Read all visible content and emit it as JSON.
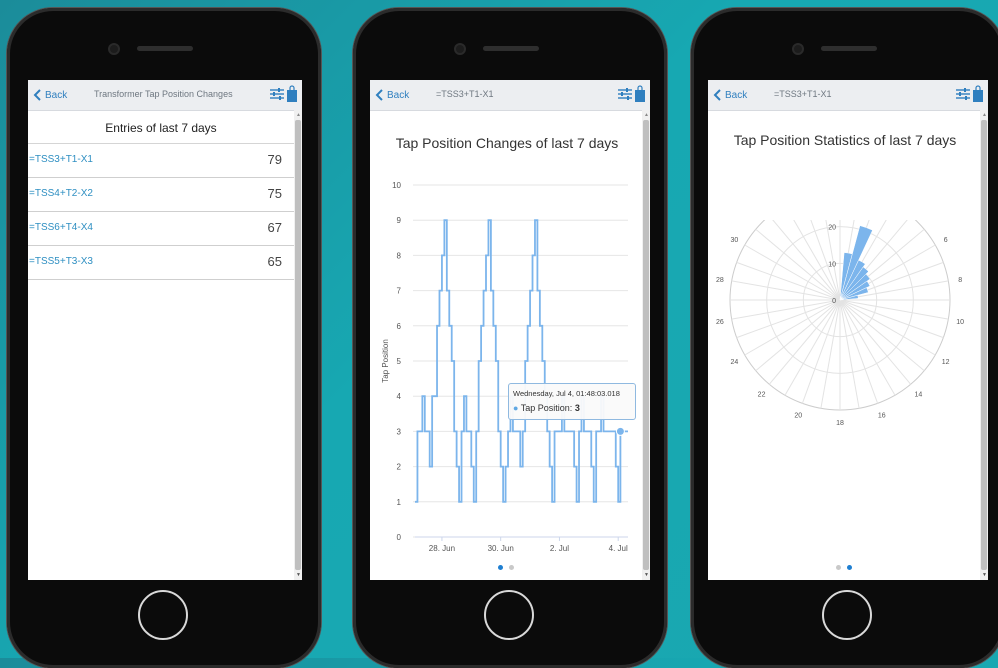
{
  "screens": [
    {
      "nav": {
        "back_label": "Back",
        "title": "Transformer Tap Position Changes"
      },
      "list": {
        "header": "Entries of last 7 days",
        "rows": [
          {
            "name": "=TSS3+T1-X1",
            "count": "79"
          },
          {
            "name": "=TSS4+T2-X2",
            "count": "75"
          },
          {
            "name": "=TSS6+T4-X4",
            "count": "67"
          },
          {
            "name": "=TSS5+T3-X3",
            "count": "65"
          }
        ]
      }
    },
    {
      "nav": {
        "back_label": "Back",
        "title": "=TSS3+T1-X1"
      },
      "pager": {
        "active": 0,
        "count": 2
      }
    },
    {
      "nav": {
        "back_label": "Back",
        "title": "=TSS3+T1-X1"
      },
      "pager": {
        "active": 1,
        "count": 2
      }
    }
  ],
  "colors": {
    "accent": "#2f7fbf",
    "series": "#7cb5ec",
    "link": "#2f8fc2"
  },
  "icons": [
    "chevron-left-icon",
    "filter-sliders-icon",
    "shopping-bag-icon"
  ],
  "chart_data": [
    {
      "type": "line",
      "title": "Tap Position Changes of last 7 days",
      "ylabel": "Tap Position",
      "ylim": [
        0,
        10
      ],
      "yticks": [
        "0",
        "1",
        "2",
        "3",
        "4",
        "5",
        "6",
        "7",
        "8",
        "9",
        "10"
      ],
      "xticks": [
        "28. Jun",
        "30. Jun",
        "2. Jul",
        "4. Jul"
      ],
      "x_unit": "date",
      "x": [
        "2018-06-27 02:00",
        "2018-06-27 04:00",
        "2018-06-27 08:00",
        "2018-06-27 10:00",
        "2018-06-27 14:00",
        "2018-06-27 16:00",
        "2018-06-27 20:00",
        "2018-06-27 22:00",
        "2018-06-28 00:00",
        "2018-06-28 02:00",
        "2018-06-28 04:00",
        "2018-06-28 06:00",
        "2018-06-28 08:00",
        "2018-06-28 10:00",
        "2018-06-28 12:00",
        "2018-06-28 14:00",
        "2018-06-28 16:00",
        "2018-06-28 18:00",
        "2018-06-28 20:00",
        "2018-06-28 22:00",
        "2018-06-29 00:00",
        "2018-06-29 02:00",
        "2018-06-29 04:00",
        "2018-06-29 06:00",
        "2018-06-29 08:00",
        "2018-06-29 10:00",
        "2018-06-29 12:00",
        "2018-06-29 14:00",
        "2018-06-29 16:00",
        "2018-06-29 18:00",
        "2018-06-29 20:00",
        "2018-06-29 22:00",
        "2018-06-30 00:00",
        "2018-06-30 02:00",
        "2018-06-30 04:00",
        "2018-06-30 06:00",
        "2018-06-30 08:00",
        "2018-06-30 10:00",
        "2018-06-30 12:00",
        "2018-06-30 14:00",
        "2018-06-30 16:00",
        "2018-06-30 18:00",
        "2018-06-30 20:00",
        "2018-06-30 22:00",
        "2018-07-01 00:00",
        "2018-07-01 02:00",
        "2018-07-01 04:00",
        "2018-07-01 06:00",
        "2018-07-01 08:00",
        "2018-07-01 10:00",
        "2018-07-01 12:00",
        "2018-07-01 14:00",
        "2018-07-01 16:00",
        "2018-07-01 18:00",
        "2018-07-01 20:00",
        "2018-07-01 22:00",
        "2018-07-02 00:00",
        "2018-07-02 02:00",
        "2018-07-02 04:00",
        "2018-07-02 06:00",
        "2018-07-02 08:00",
        "2018-07-02 10:00",
        "2018-07-02 12:00",
        "2018-07-02 14:00",
        "2018-07-02 16:00",
        "2018-07-02 18:00",
        "2018-07-02 20:00",
        "2018-07-02 22:00",
        "2018-07-03 00:00",
        "2018-07-03 02:00",
        "2018-07-03 04:00",
        "2018-07-03 06:00",
        "2018-07-03 08:00",
        "2018-07-03 10:00",
        "2018-07-03 12:00",
        "2018-07-03 14:00",
        "2018-07-03 16:00",
        "2018-07-03 18:00",
        "2018-07-03 20:00",
        "2018-07-03 22:00",
        "2018-07-04 00:00",
        "2018-07-04 01:48",
        "2018-07-04 04:00",
        "2018-07-04 08:00"
      ],
      "series": [
        {
          "values": [
            1,
            3,
            4,
            3,
            2,
            4,
            6,
            7,
            8,
            9,
            7,
            6,
            5,
            3,
            2,
            1,
            3,
            4,
            3,
            3,
            2,
            1,
            3,
            5,
            6,
            7,
            8,
            9,
            7,
            6,
            5,
            3,
            2,
            1,
            2,
            3,
            4,
            3,
            3,
            3,
            2,
            3,
            5,
            6,
            7,
            8,
            9,
            7,
            6,
            5,
            4,
            3,
            2,
            1,
            3,
            3,
            3,
            4,
            3,
            3,
            3,
            3,
            2,
            1,
            3,
            4,
            3,
            3,
            3,
            2,
            1,
            3,
            3,
            4,
            3,
            3,
            3,
            3,
            3,
            2,
            1,
            3,
            3,
            3
          ]
        }
      ],
      "tooltip": {
        "date": "Wednesday, Jul 4, 01:48:03.018",
        "label": "Tap Position:",
        "value": "3"
      },
      "grid": true
    },
    {
      "type": "polar-bar",
      "title": "Tap Position Statistics of last 7 days",
      "angular_ticks": [
        "0",
        "2",
        "4",
        "6",
        "8",
        "10",
        "12",
        "14",
        "16",
        "18",
        "20",
        "22",
        "24",
        "26",
        "28",
        "30",
        "32",
        "34"
      ],
      "radial_ticks": [
        "0",
        "10",
        "20"
      ],
      "rmax": 30,
      "categories": [
        1,
        2,
        3,
        4,
        5,
        6,
        7,
        8
      ],
      "values": [
        13,
        21,
        12,
        11,
        10,
        9,
        8,
        5
      ]
    }
  ]
}
